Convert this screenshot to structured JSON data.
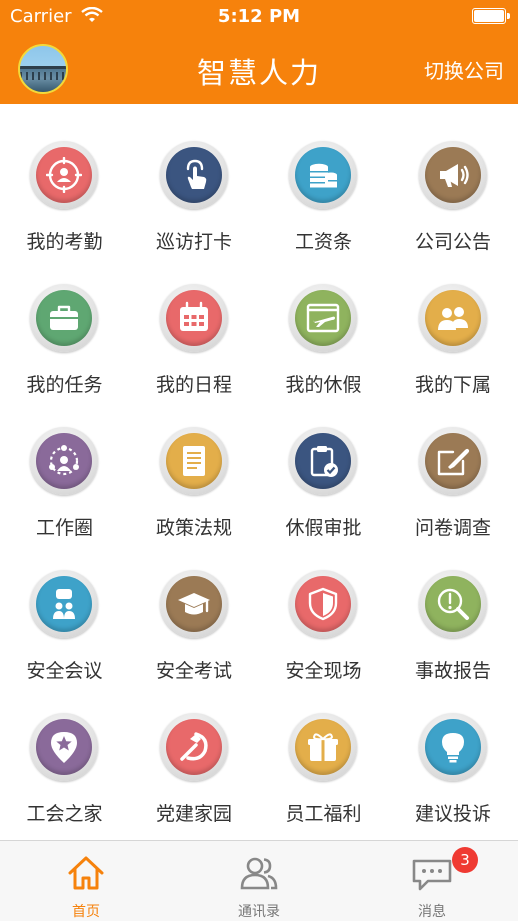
{
  "status_bar": {
    "carrier": "Carrier",
    "time": "5:12 PM"
  },
  "header": {
    "title": "智慧人力",
    "switch_label": "切换公司"
  },
  "grid": [
    {
      "label": "我的考勤",
      "icon": "attendance-icon",
      "color": "#e8696a"
    },
    {
      "label": "巡访打卡",
      "icon": "tap-hand-icon",
      "color": "#3b5580"
    },
    {
      "label": "工资条",
      "icon": "coins-icon",
      "color": "#3ea2c9"
    },
    {
      "label": "公司公告",
      "icon": "megaphone-icon",
      "color": "#9b7a55"
    },
    {
      "label": "我的任务",
      "icon": "briefcase-icon",
      "color": "#5fa772"
    },
    {
      "label": "我的日程",
      "icon": "calendar-icon",
      "color": "#e8696a"
    },
    {
      "label": "我的休假",
      "icon": "airplane-icon",
      "color": "#8fb35e"
    },
    {
      "label": "我的下属",
      "icon": "people-icon",
      "color": "#e3ae4a"
    },
    {
      "label": "工作圈",
      "icon": "circle-people-icon",
      "color": "#8a6a9a"
    },
    {
      "label": "政策法规",
      "icon": "document-icon",
      "color": "#e3ae4a"
    },
    {
      "label": "休假审批",
      "icon": "clipboard-check-icon",
      "color": "#3b5580"
    },
    {
      "label": "问卷调查",
      "icon": "pen-board-icon",
      "color": "#9b7a55"
    },
    {
      "label": "安全会议",
      "icon": "meeting-icon",
      "color": "#3ea2c9"
    },
    {
      "label": "安全考试",
      "icon": "graduation-cap-icon",
      "color": "#9b7a55"
    },
    {
      "label": "安全现场",
      "icon": "shield-icon",
      "color": "#e8696a"
    },
    {
      "label": "事故报告",
      "icon": "search-alert-icon",
      "color": "#8fb35e"
    },
    {
      "label": "工会之家",
      "icon": "star-pin-icon",
      "color": "#8a6a9a"
    },
    {
      "label": "党建家园",
      "icon": "hammer-sickle-icon",
      "color": "#e8696a"
    },
    {
      "label": "员工福利",
      "icon": "gift-icon",
      "color": "#e3ae4a"
    },
    {
      "label": "建议投诉",
      "icon": "lightbulb-icon",
      "color": "#3ea2c9"
    }
  ],
  "tabbar": {
    "items": [
      {
        "label": "首页",
        "icon": "home-icon",
        "active": true
      },
      {
        "label": "通讯录",
        "icon": "contacts-icon",
        "active": false
      },
      {
        "label": "消息",
        "icon": "message-icon",
        "active": false,
        "badge": "3"
      }
    ]
  },
  "colors": {
    "accent": "#f6820c",
    "badge": "#ef3a32"
  }
}
